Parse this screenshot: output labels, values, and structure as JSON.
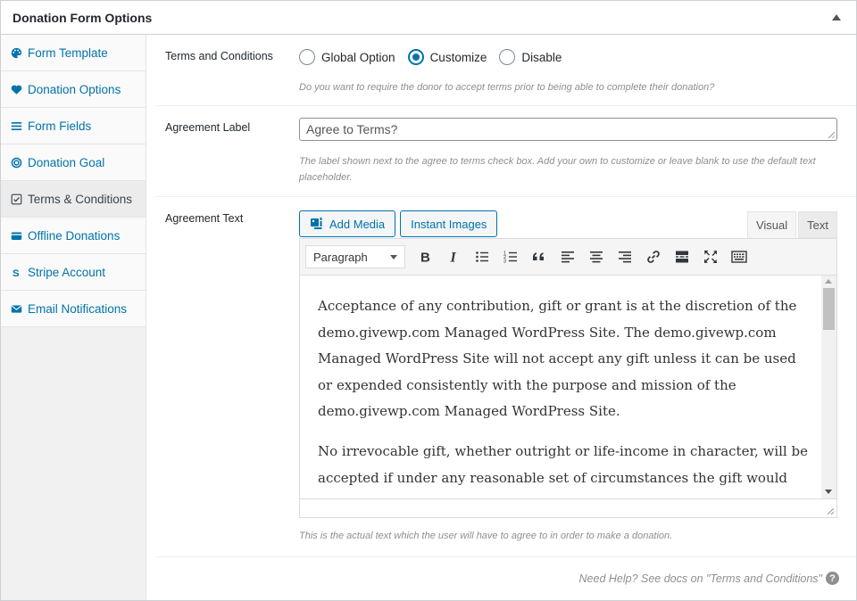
{
  "metabox": {
    "title": "Donation Form Options"
  },
  "sidebar": {
    "items": [
      {
        "label": "Form Template",
        "icon": "palette-icon"
      },
      {
        "label": "Donation Options",
        "icon": "heart-icon"
      },
      {
        "label": "Form Fields",
        "icon": "list-icon"
      },
      {
        "label": "Donation Goal",
        "icon": "target-icon"
      },
      {
        "label": "Terms & Conditions",
        "icon": "checkbox-icon",
        "active": true
      },
      {
        "label": "Offline Donations",
        "icon": "wallet-icon"
      },
      {
        "label": "Stripe Account",
        "icon": "stripe-icon"
      },
      {
        "label": "Email Notifications",
        "icon": "envelope-icon"
      }
    ]
  },
  "terms": {
    "label": "Terms and Conditions",
    "options": [
      "Global Option",
      "Customize",
      "Disable"
    ],
    "selected": "Customize",
    "description": "Do you want to require the donor to accept terms prior to being able to complete their donation?"
  },
  "agreement_label": {
    "label": "Agreement Label",
    "placeholder": "Agree to Terms?",
    "description": "The label shown next to the agree to terms check box. Add your own to customize or leave blank to use the default text placeholder."
  },
  "agreement_text": {
    "label": "Agreement Text",
    "add_media": "Add Media",
    "instant_images": "Instant Images",
    "tab_visual": "Visual",
    "tab_text": "Text",
    "format": "Paragraph",
    "paragraphs": [
      "Acceptance of any contribution, gift or grant is at the discretion of the demo.givewp.com Managed WordPress Site. The demo.givewp.com Managed WordPress Site will not accept any gift unless it can be used or expended consistently with the purpose and mission of the demo.givewp.com Managed WordPress Site.",
      "No irrevocable gift, whether outright or life-income in character, will be accepted if under any reasonable set of circumstances the gift would"
    ],
    "description": "This is the actual text which the user will have to agree to in order to make a donation."
  },
  "help": {
    "text": "Need Help? See docs on \"Terms and Conditions\"",
    "icon_glyph": "?"
  },
  "colors": {
    "accent": "#0073aa",
    "muted": "#8c8f94"
  }
}
